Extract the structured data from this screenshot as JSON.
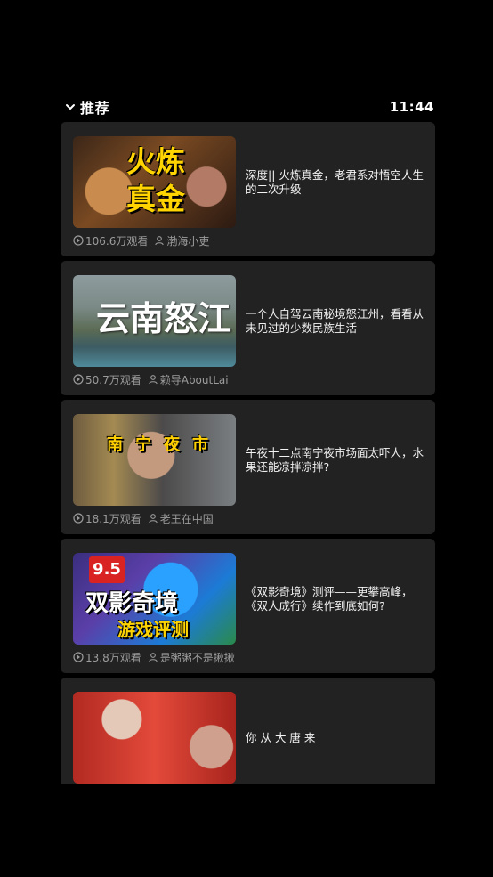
{
  "header": {
    "title": "推荐",
    "time": "11:44"
  },
  "videos": [
    {
      "title": "深度|| 火炼真金，老君系对悟空人生的二次升级",
      "views": "106.6万观看",
      "author": "渤海小吏",
      "thumb_text": "火炼真金"
    },
    {
      "title": "一个人自驾云南秘境怒江州，看看从未见过的少数民族生活",
      "views": "50.7万观看",
      "author": "赖导AboutLai",
      "thumb_text": "云南怒江"
    },
    {
      "title": "午夜十二点南宁夜市场面太吓人，水果还能凉拌凉拌?",
      "views": "18.1万观看",
      "author": "老王在中国",
      "thumb_text": "南宁夜市"
    },
    {
      "title": "《双影奇境》测评——更攀高峰，《双人成行》续作到底如何?",
      "views": "13.8万观看",
      "author": "是粥粥不是揪揪",
      "thumb_text": "双影奇境",
      "thumb_text2": "游戏评测",
      "thumb_score": "9.5"
    },
    {
      "title": "你 从 大 唐 来",
      "views": "",
      "author": ""
    }
  ]
}
